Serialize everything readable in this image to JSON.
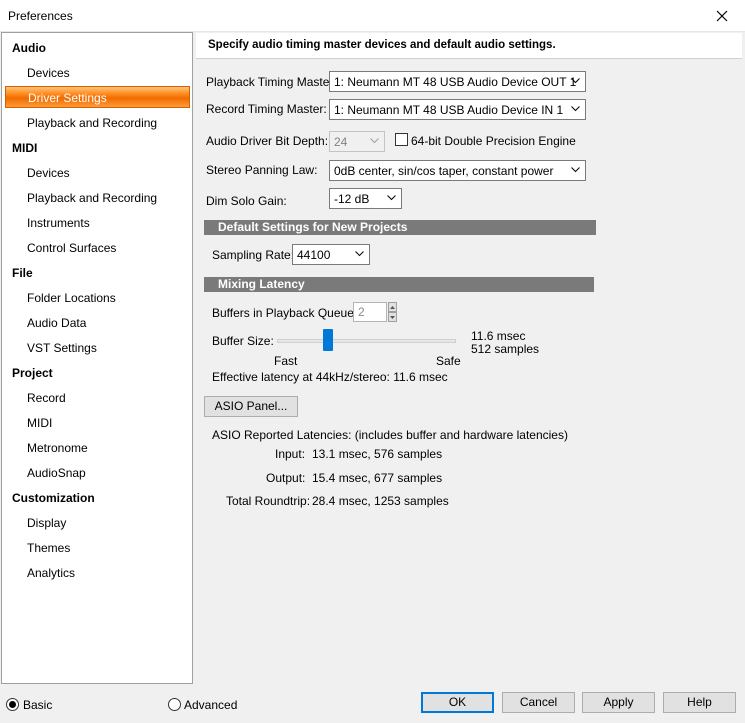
{
  "window": {
    "title": "Preferences"
  },
  "sidebar": {
    "audio": {
      "label": "Audio",
      "items": [
        "Devices",
        "Driver Settings",
        "Playback and Recording"
      ]
    },
    "midi": {
      "label": "MIDI",
      "items": [
        "Devices",
        "Playback and Recording",
        "Instruments",
        "Control Surfaces"
      ]
    },
    "file": {
      "label": "File",
      "items": [
        "Folder Locations",
        "Audio Data",
        "VST Settings"
      ]
    },
    "project": {
      "label": "Project",
      "items": [
        "Record",
        "MIDI",
        "Metronome",
        "AudioSnap"
      ]
    },
    "customization": {
      "label": "Customization",
      "items": [
        "Display",
        "Themes",
        "Analytics"
      ]
    },
    "selected": "Driver Settings"
  },
  "content": {
    "header": "Specify audio timing master devices and default audio settings.",
    "playback_master": {
      "label": "Playback Timing Master:",
      "value": "1: Neumann MT 48 USB Audio Device OUT 1"
    },
    "record_master": {
      "label": "Record Timing Master:",
      "value": "1: Neumann MT 48 USB Audio Device IN 1"
    },
    "bit_depth": {
      "label": "Audio Driver Bit Depth:",
      "value": "24",
      "checkbox_label": "64-bit Double Precision Engine",
      "checked": false
    },
    "panning": {
      "label": "Stereo Panning Law:",
      "value": "0dB center, sin/cos taper, constant power"
    },
    "dim_solo": {
      "label": "Dim Solo Gain:",
      "value": "-12 dB"
    },
    "defaults_section": "Default Settings for New Projects",
    "sampling_rate": {
      "label": "Sampling Rate:",
      "value": "44100"
    },
    "latency_section": "Mixing Latency",
    "buffers": {
      "label": "Buffers in Playback Queue:",
      "value": "2"
    },
    "buffer_size": {
      "label": "Buffer Size:",
      "msec": "11.6 msec",
      "samples": "512 samples",
      "fast": "Fast",
      "safe": "Safe",
      "slider_fraction": 0.27
    },
    "effective_latency": "Effective latency at 44kHz/stereo:  11.6 msec",
    "asio_button": "ASIO Panel...",
    "asio_reported": "ASIO Reported Latencies: (includes buffer and hardware latencies)",
    "input": {
      "label": "Input:",
      "value": "13.1 msec, 576 samples"
    },
    "output": {
      "label": "Output:",
      "value": "15.4 msec, 677 samples"
    },
    "roundtrip": {
      "label": "Total Roundtrip:",
      "value": "28.4 msec, 1253 samples"
    }
  },
  "footer": {
    "basic": "Basic",
    "advanced": "Advanced",
    "mode": "Basic",
    "ok": "OK",
    "cancel": "Cancel",
    "apply": "Apply",
    "help": "Help"
  },
  "colors": {
    "accent": "#0078d7",
    "selection": "#f06b00",
    "section_bar": "#7a7a7a"
  }
}
